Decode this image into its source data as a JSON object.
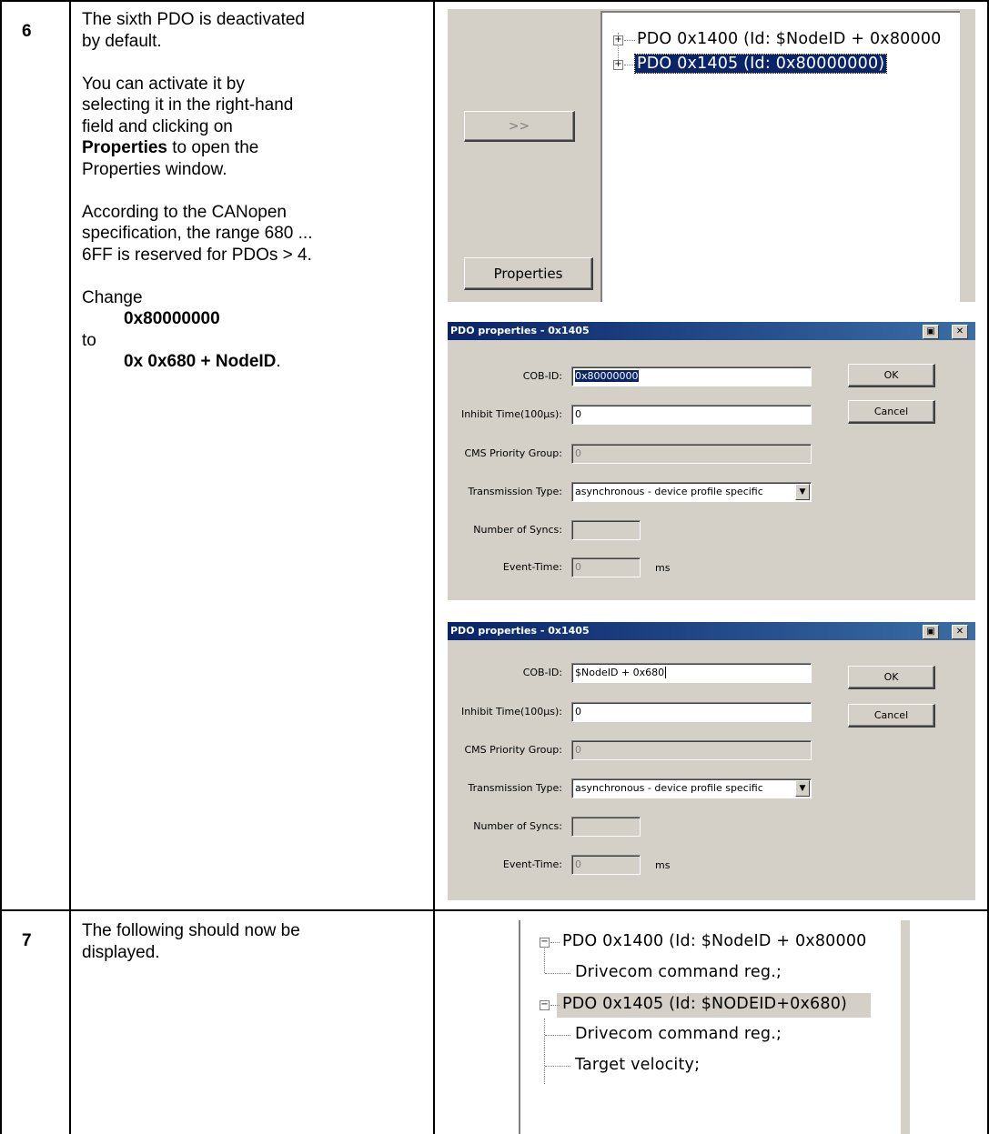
{
  "steps": [
    {
      "number": "6",
      "text": {
        "p1": "The sixth PDO is deactivated",
        "p1b": "by default.",
        "p2a": "You can activate it by",
        "p2b": "selecting it in the right-hand",
        "p2c": "field and clicking on",
        "p2d_bold": "Properties",
        "p2d_rest": " to open the",
        "p2e": "Properties window.",
        "p3a": "According to the CANopen",
        "p3b": "specification, the range 680 ...",
        "p3c": "6FF is reserved for PDOs > 4.",
        "change": "Change",
        "from": "0x80000000",
        "to": " to",
        "target": "0x 0x680 + NodeID",
        "period": "."
      },
      "tree_panel": {
        "arrow_button": ">>",
        "properties_button": "Properties",
        "nodes": [
          "PDO 0x1400 (Id: $NodeID + 0x80000",
          "PDO 0x1405 (Id: 0x80000000)"
        ]
      },
      "dialogs": [
        {
          "title": "PDO properties - 0x1405",
          "cob_id_label": "COB-ID:",
          "cob_id_value": "0x80000000",
          "inhibit_label": "Inhibit Time(100µs):",
          "inhibit_value": "0",
          "cms_label": "CMS Priority Group:",
          "cms_value": "0",
          "transmission_label": "Transmission Type:",
          "transmission_value": "asynchronous - device profile specific",
          "syncs_label": "Number of Syncs:",
          "syncs_value": "",
          "event_label": "Event-Time:",
          "event_value": "0",
          "event_unit": "ms",
          "ok": "OK",
          "cancel": "Cancel"
        },
        {
          "title": "PDO properties - 0x1405",
          "cob_id_label": "COB-ID:",
          "cob_id_value": "$NodeID + 0x680",
          "inhibit_label": "Inhibit Time(100µs):",
          "inhibit_value": "0",
          "cms_label": "CMS Priority Group:",
          "cms_value": "0",
          "transmission_label": "Transmission Type:",
          "transmission_value": "asynchronous - device profile specific",
          "syncs_label": "Number of Syncs:",
          "syncs_value": "",
          "event_label": "Event-Time:",
          "event_value": "0",
          "event_unit": "ms",
          "ok": "OK",
          "cancel": "Cancel"
        }
      ]
    },
    {
      "number": "7",
      "text": {
        "p1": "The following should now be",
        "p1b": "displayed."
      },
      "tree": {
        "node1": "PDO 0x1400 (Id: $NodeID + 0x80000",
        "node1_child": "Drivecom command reg.;",
        "node2": "PDO 0x1405 (Id: $NODEID+0x680)",
        "node2_child1": "Drivecom command reg.;",
        "node2_child2": "Target velocity;"
      }
    }
  ]
}
